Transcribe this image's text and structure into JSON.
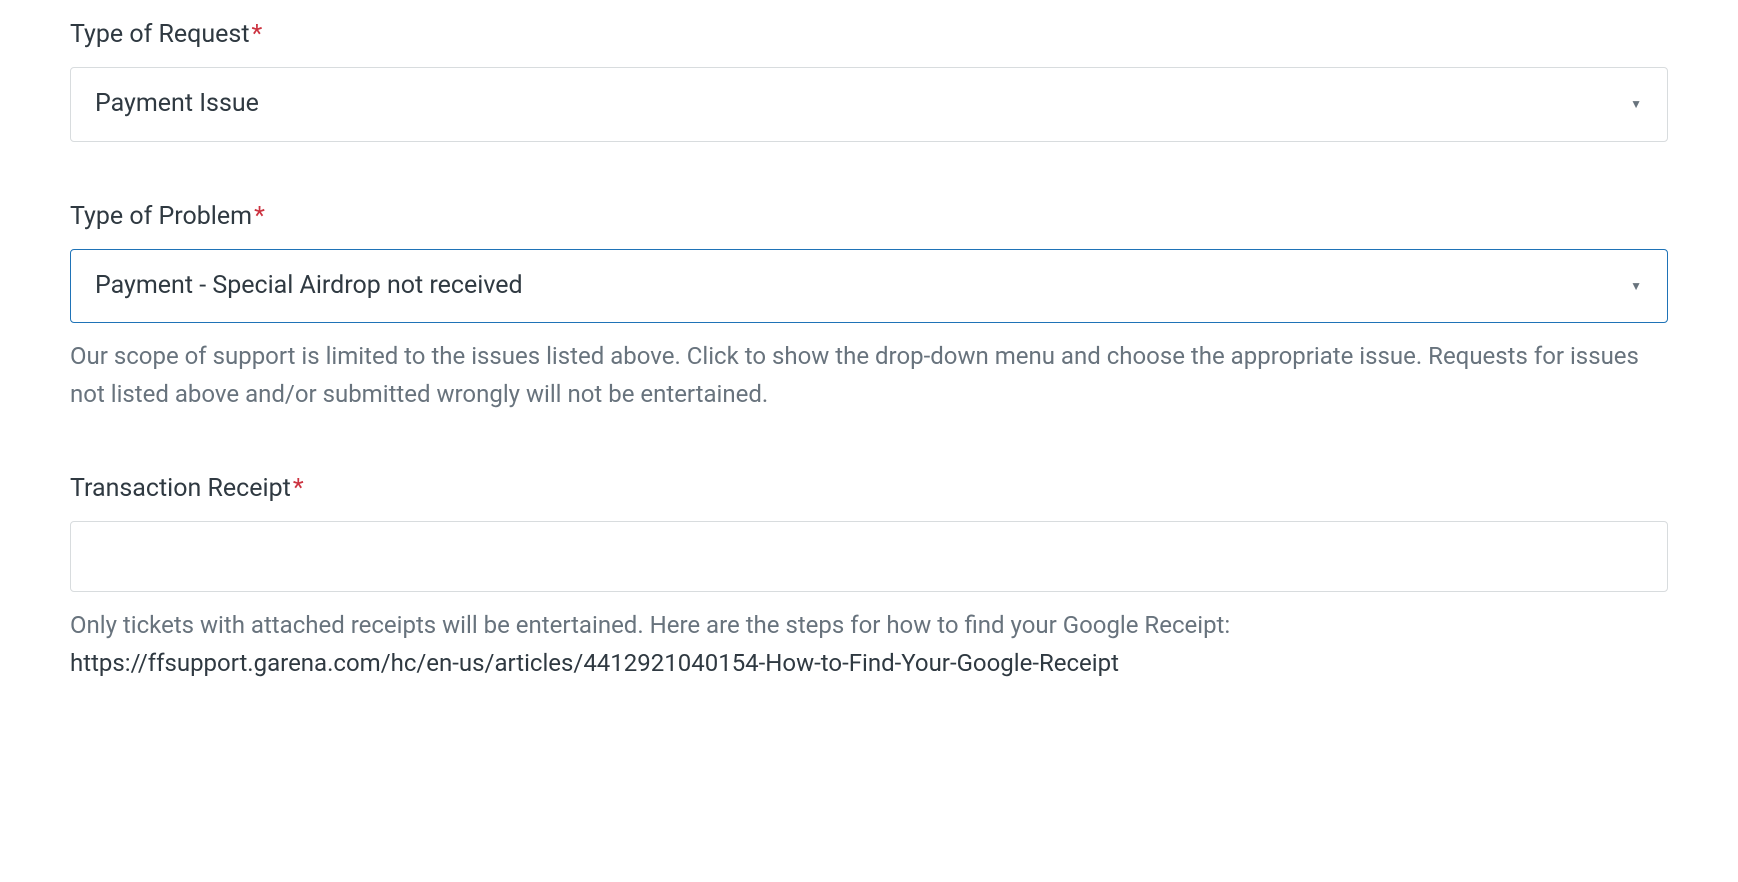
{
  "form": {
    "typeOfRequest": {
      "label": "Type of Request",
      "required": "*",
      "value": "Payment Issue"
    },
    "typeOfProblem": {
      "label": "Type of Problem",
      "required": "*",
      "value": "Payment - Special Airdrop not received",
      "helperText": "Our scope of support is limited to the issues listed above. Click to show the drop-down menu and choose the appropriate issue. Requests for issues not listed above and/or submitted wrongly will not be entertained."
    },
    "transactionReceipt": {
      "label": "Transaction Receipt",
      "required": "*",
      "value": "",
      "helperText": "Only tickets with attached receipts will be entertained. Here are the steps for how to find your Google Receipt:",
      "linkText": "https://ffsupport.garena.com/hc/en-us/articles/4412921040154-How-to-Find-Your-Google-Receipt"
    }
  }
}
